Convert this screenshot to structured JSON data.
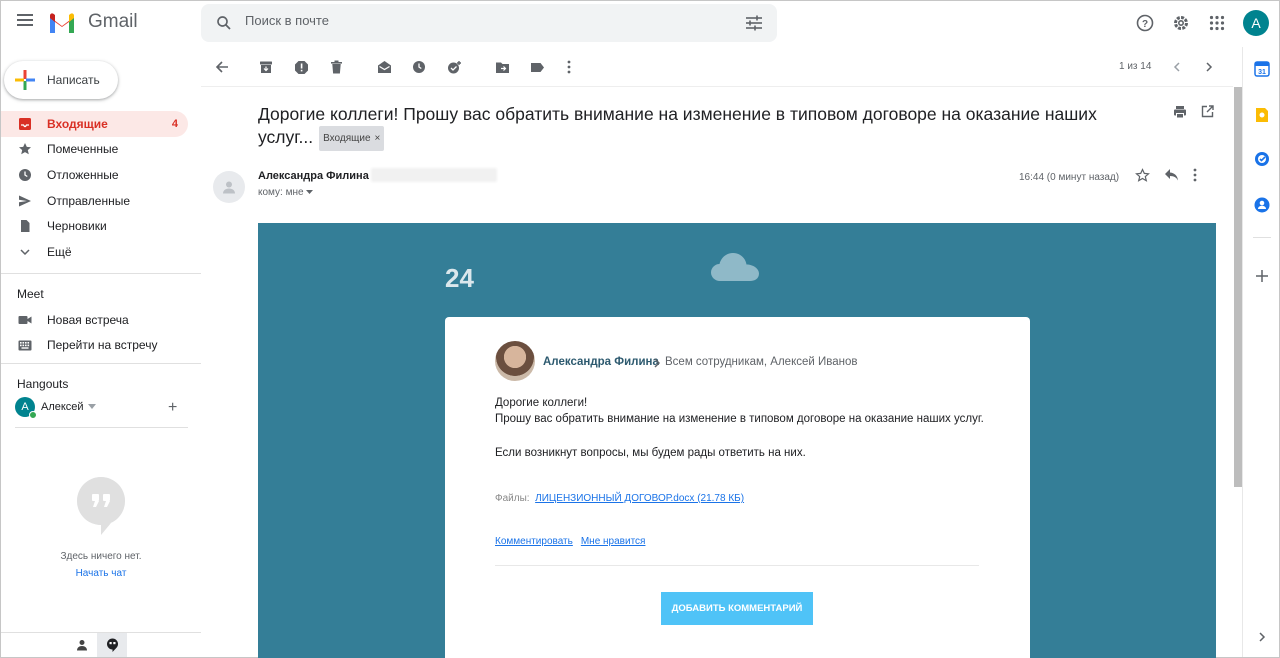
{
  "app": {
    "name": "Gmail"
  },
  "search": {
    "placeholder": "Поиск в почте"
  },
  "user": {
    "initial": "A"
  },
  "compose": {
    "label": "Написать"
  },
  "nav": [
    {
      "label": "Входящие",
      "count": "4"
    },
    {
      "label": "Помеченные"
    },
    {
      "label": "Отложенные"
    },
    {
      "label": "Отправленные"
    },
    {
      "label": "Черновики"
    },
    {
      "label": "Ещё"
    }
  ],
  "meet": {
    "title": "Meet",
    "items": [
      {
        "label": "Новая встреча"
      },
      {
        "label": "Перейти на встречу"
      }
    ]
  },
  "hangouts": {
    "title": "Hangouts",
    "user_name": "Алексей",
    "user_initial": "A",
    "empty_text": "Здесь ничего нет.",
    "start_chat": "Начать чат"
  },
  "pager": {
    "text": "1 из 14"
  },
  "message": {
    "subject": "Дорогие коллеги! Прошу вас обратить внимание на изменение в типовом договоре на оказание наших услуг...",
    "label": "Входящие",
    "sender_name": "Александра Филина",
    "to": "кому: мне",
    "time": "16:44 (0 минут назад)"
  },
  "email": {
    "day": "24",
    "author": "Александра Филина",
    "recipients": "Всем сотрудникам, Алексей Иванов",
    "greeting": "Дорогие коллеги!",
    "body1": "Прошу вас обратить внимание на изменение в типовом договоре на оказание наших услуг.",
    "body2": "Если возникнут вопросы, мы будем рады ответить на них.",
    "files_label": "Файлы:",
    "file_link": "ЛИЦЕНЗИОННЫЙ ДОГОВОР.docx (21.78 КБ)",
    "comment_link": "Комментировать",
    "like_link": "Мне нравится",
    "add_comment": "ДОБАВИТЬ КОММЕНТАРИЙ"
  },
  "colors": {
    "accent": "#d93025",
    "email_bg": "#347e97",
    "button": "#4fc3f7",
    "link": "#1a73e8"
  }
}
